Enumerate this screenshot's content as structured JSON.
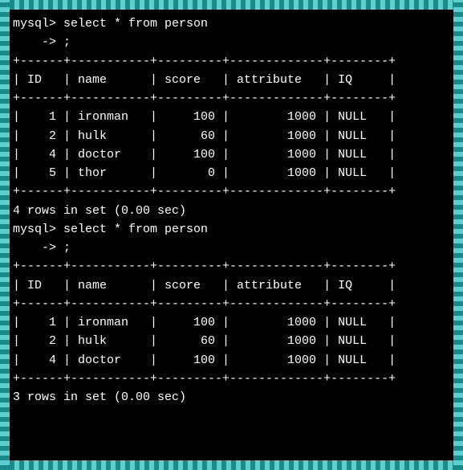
{
  "prompt": "mysql>",
  "continuation": "    ->",
  "query1": {
    "command": "select * from person",
    "terminator": ";",
    "columns": [
      "ID",
      "name",
      "score",
      "attribute",
      "IQ"
    ],
    "rows": [
      {
        "ID": "1",
        "name": "ironman",
        "score": "100",
        "attribute": "1000",
        "IQ": "NULL"
      },
      {
        "ID": "2",
        "name": "hulk",
        "score": "60",
        "attribute": "1000",
        "IQ": "NULL"
      },
      {
        "ID": "4",
        "name": "doctor",
        "score": "100",
        "attribute": "1000",
        "IQ": "NULL"
      },
      {
        "ID": "5",
        "name": "thor",
        "score": "0",
        "attribute": "1000",
        "IQ": "NULL"
      }
    ],
    "result_status": "4 rows in set (0.00 sec)"
  },
  "query2": {
    "command": "select * from person",
    "terminator": ";",
    "columns": [
      "ID",
      "name",
      "score",
      "attribute",
      "IQ"
    ],
    "rows": [
      {
        "ID": "1",
        "name": "ironman",
        "score": "100",
        "attribute": "1000",
        "IQ": "NULL"
      },
      {
        "ID": "2",
        "name": "hulk",
        "score": "60",
        "attribute": "1000",
        "IQ": "NULL"
      },
      {
        "ID": "4",
        "name": "doctor",
        "score": "100",
        "attribute": "1000",
        "IQ": "NULL"
      }
    ],
    "result_status": "3 rows in set (0.00 sec)"
  },
  "col_widths": {
    "ID": 4,
    "name": 9,
    "score": 7,
    "attribute": 11,
    "IQ": 6
  }
}
